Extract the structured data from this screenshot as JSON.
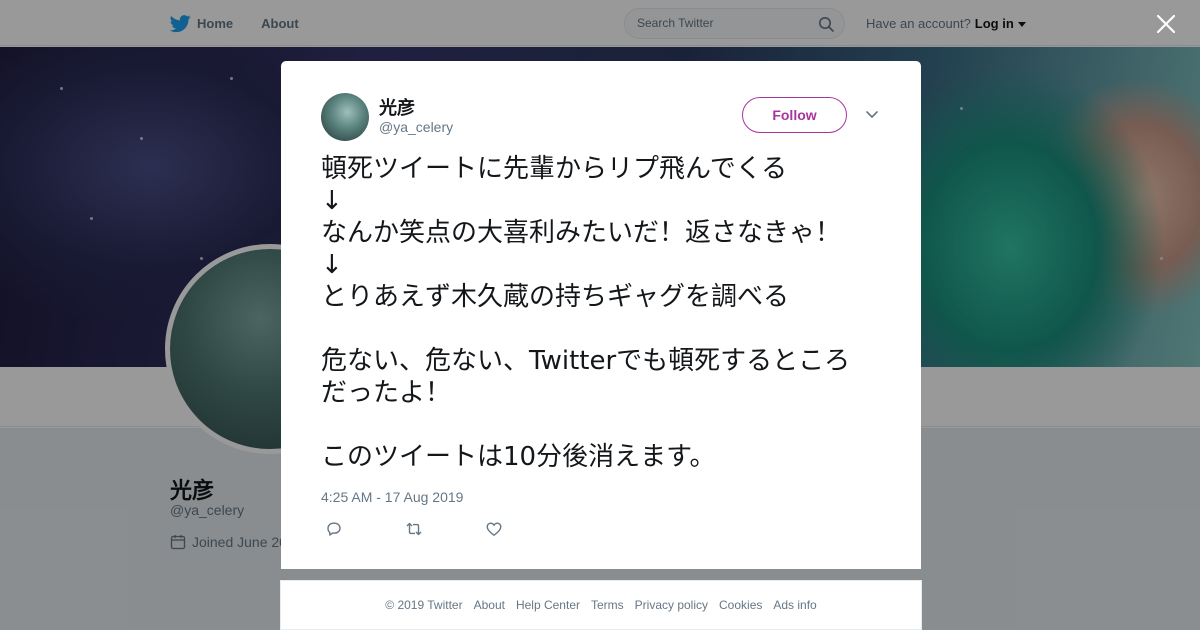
{
  "topnav": {
    "home_label": "Home",
    "about_label": "About",
    "search_placeholder": "Search Twitter",
    "account_prompt": "Have an account?",
    "login_label": "Log in",
    "brand_color": "#1da1f2"
  },
  "profile": {
    "name": "光彦",
    "handle": "@ya_celery",
    "joined": "Joined June 20"
  },
  "modal": {
    "close_icon": "close-icon",
    "author_name": "光彦",
    "author_handle": "@ya_celery",
    "follow_label": "Follow",
    "follow_color": "#a8359e",
    "tweet_lines": [
      "頓死ツイートに先輩からリプ飛んでくる",
      "↓",
      "なんか笑点の大喜利みたいだ！返さなきゃ！",
      "↓",
      "とりあえず木久蔵の持ちギャグを調べる",
      "",
      "危ない、危ない、Twitterでも頓死するところ",
      "だったよ！",
      "",
      "このツイートは10分後消えます。"
    ],
    "timestamp": "4:25 AM - 17 Aug 2019",
    "actions": [
      "reply-icon",
      "retweet-icon",
      "like-icon"
    ]
  },
  "footer": {
    "links": [
      "© 2019 Twitter",
      "About",
      "Help Center",
      "Terms",
      "Privacy policy",
      "Cookies",
      "Ads info"
    ]
  }
}
